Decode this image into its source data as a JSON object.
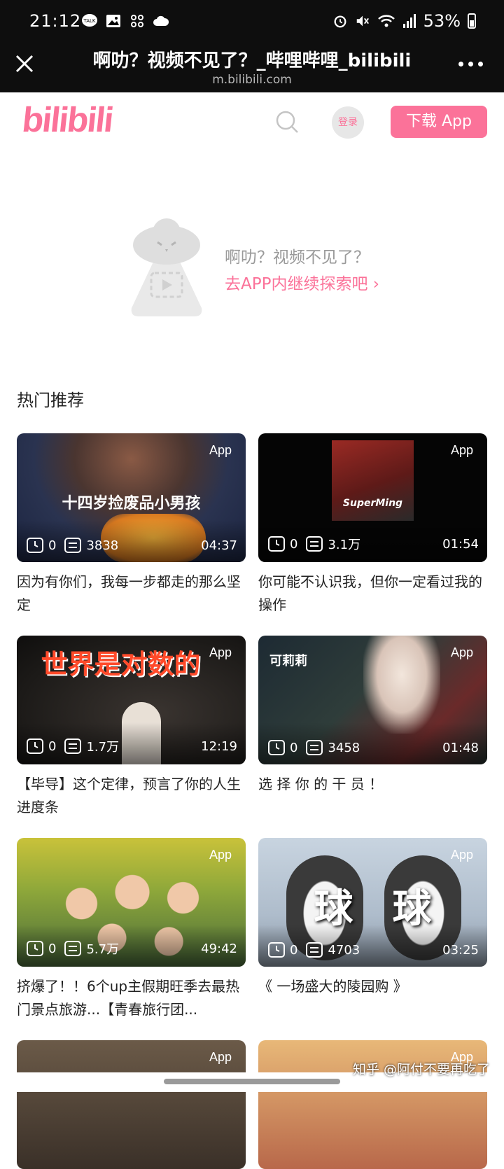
{
  "status_bar": {
    "time": "21:12",
    "battery": "53%"
  },
  "browser": {
    "title": "啊叻？视频不见了？_哔哩哔哩_bilibili",
    "url": "m.bilibili.com"
  },
  "header": {
    "logo_text": "bilibili",
    "login_label": "登录",
    "download_label": "下载 App"
  },
  "empty_state": {
    "message": "啊叻？视频不见了？",
    "link": "去APP内继续探索吧 ›"
  },
  "section_title": "热门推荐",
  "videos": [
    {
      "title": "因为有你们，我每一步都走的那么坚定",
      "badge": "App",
      "plays": "0",
      "danmaku": "3838",
      "duration": "04:37",
      "caption": "十四岁捡废品小男孩"
    },
    {
      "title": "你可能不认识我，但你一定看过我的操作",
      "badge": "App",
      "plays": "0",
      "danmaku": "3.1万",
      "duration": "01:54",
      "caption": "SuperMing"
    },
    {
      "title": "【毕导】这个定律，预言了你的人生进度条",
      "badge": "App",
      "plays": "0",
      "danmaku": "1.7万",
      "duration": "12:19",
      "caption": "世界是对数的"
    },
    {
      "title": "选 择 你 的 干 员 ！",
      "badge": "App",
      "plays": "0",
      "danmaku": "3458",
      "duration": "01:48",
      "caption": "可莉莉"
    },
    {
      "title": "挤爆了！！6个up主假期旺季去最热门景点旅游...【青春旅行团...",
      "badge": "App",
      "plays": "0",
      "danmaku": "5.7万",
      "duration": "49:42",
      "caption": ""
    },
    {
      "title": "《 一场盛大的陵园购 》",
      "badge": "App",
      "plays": "0",
      "danmaku": "4703",
      "duration": "03:25",
      "caption": "球　球"
    },
    {
      "title": "",
      "badge": "App",
      "plays": "",
      "danmaku": "",
      "duration": "",
      "caption": ""
    },
    {
      "title": "",
      "badge": "App",
      "plays": "",
      "danmaku": "",
      "duration": "",
      "caption": ""
    }
  ],
  "watermark": "知乎 @阿付不要再吃了",
  "colors": {
    "accent": "#fb7299",
    "dark_bar": "#0e0e0e"
  }
}
